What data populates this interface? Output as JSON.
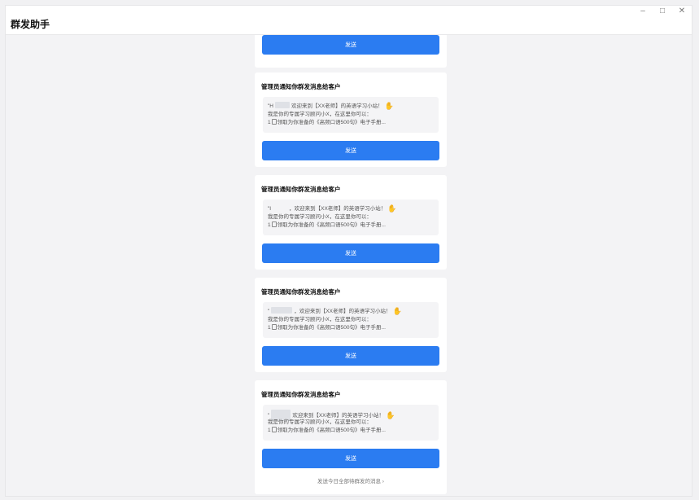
{
  "app": {
    "title": "群发助手",
    "controls": {
      "minimize": "–",
      "maximize": "□",
      "close": "✕"
    }
  },
  "send_label": "发送",
  "cards": [
    {
      "title": "管理员通知你群发消息给客户",
      "greeting_prefix": "\"H",
      "greeting_suffix": "欢迎来到【XX老师】的英语学习小站！",
      "line2": "我是你的专属学习顾问小X，在这里你可以：",
      "line3_prefix": "1",
      "line3_suffix": "领取为你准备的《高频口语500句》电子手册..."
    },
    {
      "title": "管理员通知你群发消息给客户",
      "greeting_prefix": "\"I",
      "greeting_suffix": "，欢迎来到【XX老师】的英语学习小站！",
      "line2": "我是你的专属学习顾问小X，在这里你可以：",
      "line3_prefix": "1",
      "line3_suffix": "领取为你准备的《高频口语500句》电子手册..."
    },
    {
      "title": "管理员通知你群发消息给客户",
      "greeting_prefix": "\"",
      "greeting_suffix": "，欢迎来到【XX老师】的英语学习小站！",
      "line2": "我是你的专属学习顾问小X，在这里你可以：",
      "line3_prefix": "1",
      "line3_suffix": "领取为你准备的《高频口语500句》电子手册..."
    },
    {
      "title": "管理员通知你群发消息给客户",
      "greeting_prefix": "\"",
      "greeting_suffix": "欢迎来到【XX老师】的英语学习小站！",
      "line2": "我是你的专属学习顾问小X，在这里你可以：",
      "line3_prefix": "1",
      "line3_suffix": "领取为你准备的《高频口语500句》电子手册..."
    }
  ],
  "footer": {
    "link": "发送今日全部待群发的消息 ›"
  }
}
